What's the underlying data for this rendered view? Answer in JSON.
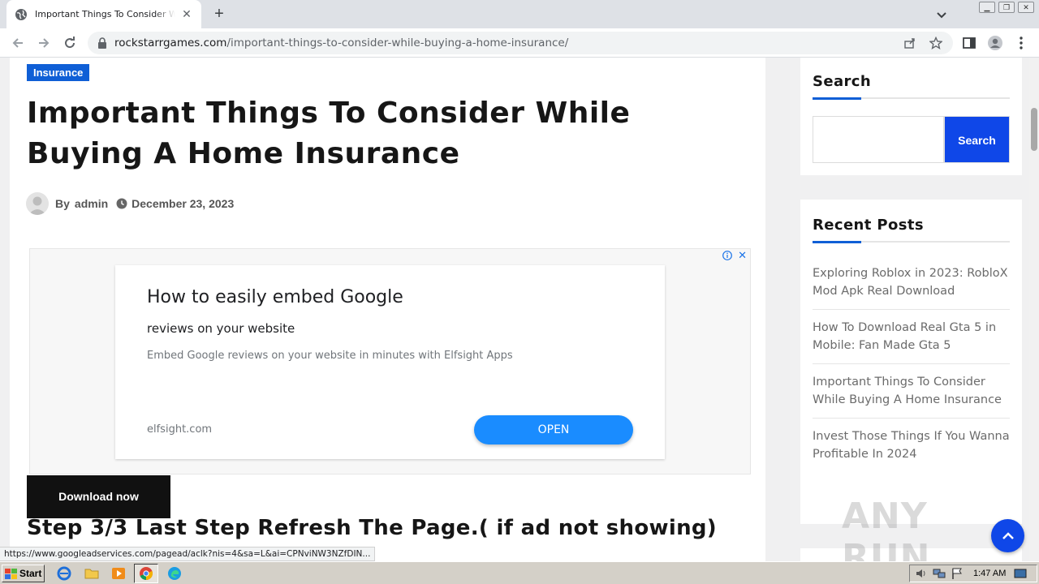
{
  "browser": {
    "tab_title": "Important Things To Consider While Buying A Home Insurance",
    "url_domain": "rockstarrgames.com",
    "url_path": "/important-things-to-consider-while-buying-a-home-insurance/",
    "status_url": "https://www.googleadservices.com/pagead/aclk?nis=4&sa=L&ai=CPNviNW3NZfDIN..."
  },
  "article": {
    "category": "Insurance",
    "title": "Important Things To Consider While Buying A Home Insurance",
    "by_label": "By",
    "author": "admin",
    "date": "December 23, 2023",
    "download_label": "Download now",
    "step_heading": "Step 3/3 Last Step Refresh The Page.( if ad not showing)"
  },
  "ad": {
    "headline": "How to easily embed Google",
    "subheadline": "reviews on your website",
    "description": "Embed Google reviews on your website in minutes with Elfsight Apps",
    "domain": "elfsight.com",
    "cta": "OPEN",
    "info_icon": "info-icon",
    "close_icon": "close-icon"
  },
  "sidebar": {
    "search": {
      "title": "Search",
      "placeholder": "",
      "button": "Search"
    },
    "recent": {
      "title": "Recent Posts",
      "posts": [
        "Exploring Roblox in 2023: RobloX Mod Apk Real Download",
        "How To Download Real Gta 5 in Mobile: Fan Made Gta 5",
        "Important Things To Consider While Buying A Home Insurance",
        "Invest Those Things If You Wanna Profitable In 2024"
      ]
    }
  },
  "watermark": "ANY RUN",
  "taskbar": {
    "start": "Start",
    "clock": "1:47 AM"
  },
  "colors": {
    "accent": "#0f5fd6",
    "search_button": "#0f47e8",
    "ad_button": "#1a8cff"
  }
}
